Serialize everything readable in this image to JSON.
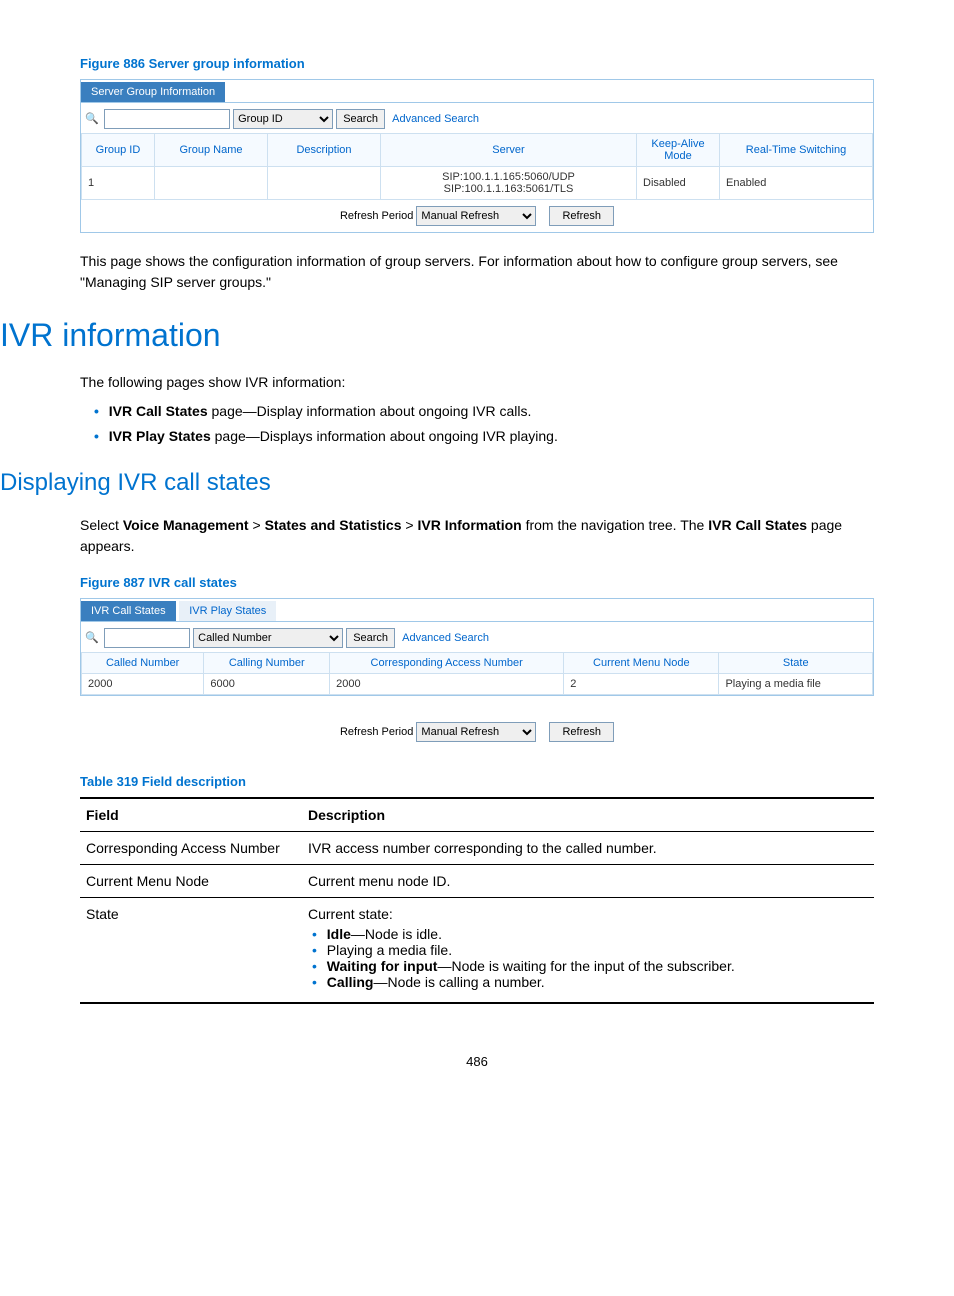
{
  "figure886": {
    "caption": "Figure 886 Server group information",
    "tab_label": "Server Group Information",
    "search": {
      "field_options": [
        "Group ID"
      ],
      "selected": "Group ID",
      "search_btn": "Search",
      "advanced": "Advanced Search"
    },
    "columns": [
      "Group ID",
      "Group Name",
      "Description",
      "Server",
      "Keep-Alive Mode",
      "Real-Time Switching"
    ],
    "rows": [
      {
        "group_id": "1",
        "group_name": "",
        "description": "",
        "server": "SIP:100.1.1.165:5060/UDP\nSIP:100.1.1.163:5061/TLS",
        "keep_alive": "Disabled",
        "switching": "Enabled"
      }
    ],
    "refresh_label": "Refresh Period",
    "refresh_options": [
      "Manual Refresh"
    ],
    "refresh_selected": "Manual Refresh",
    "refresh_btn": "Refresh"
  },
  "para_config": "This page shows the configuration information of group servers. For information about how to configure group servers, see \"Managing SIP server groups.\"",
  "h1_ivr": "IVR information",
  "para_following": "The following pages show IVR information:",
  "ivr_bullets": [
    {
      "bold": "IVR Call States",
      "rest": " page—Display information about ongoing IVR calls."
    },
    {
      "bold": "IVR Play States",
      "rest": " page—Displays information about ongoing IVR playing."
    }
  ],
  "h2_disp": "Displaying IVR call states",
  "nav_sentence": {
    "p1": "Select ",
    "b1": "Voice Management",
    "gt1": " > ",
    "b2": "States and Statistics",
    "gt2": " > ",
    "b3": "IVR Information",
    "p2": " from the navigation tree. The ",
    "b4": "IVR Call States",
    "p3": " page appears."
  },
  "figure887": {
    "caption": "Figure 887 IVR call states",
    "tabs": [
      {
        "label": "IVR Call States",
        "active": true
      },
      {
        "label": "IVR Play States",
        "active": false
      }
    ],
    "search": {
      "field_options": [
        "Called Number"
      ],
      "selected": "Called Number",
      "search_btn": "Search",
      "advanced": "Advanced Search"
    },
    "columns": [
      "Called Number",
      "Calling Number",
      "Corresponding Access Number",
      "Current Menu Node",
      "State"
    ],
    "rows": [
      {
        "called": "2000",
        "calling": "6000",
        "access": "2000",
        "node": "2",
        "state": "Playing a media file"
      }
    ],
    "refresh_label": "Refresh Period",
    "refresh_options": [
      "Manual Refresh"
    ],
    "refresh_selected": "Manual Refresh",
    "refresh_btn": "Refresh"
  },
  "table319": {
    "caption": "Table 319 Field description",
    "head_field": "Field",
    "head_desc": "Description",
    "rows": [
      {
        "field": "Corresponding Access Number",
        "desc_plain": "IVR access number corresponding to the called number."
      },
      {
        "field": "Current Menu Node",
        "desc_plain": "Current menu node ID."
      },
      {
        "field": "State",
        "desc_intro": "Current state:",
        "items": [
          {
            "bold": "Idle",
            "rest": "—Node is idle."
          },
          {
            "plain": "Playing a media file."
          },
          {
            "bold": "Waiting for input",
            "rest": "—Node is waiting for the input of the subscriber."
          },
          {
            "bold": "Calling",
            "rest": "—Node is calling a number."
          }
        ]
      }
    ]
  },
  "page_number": "486"
}
